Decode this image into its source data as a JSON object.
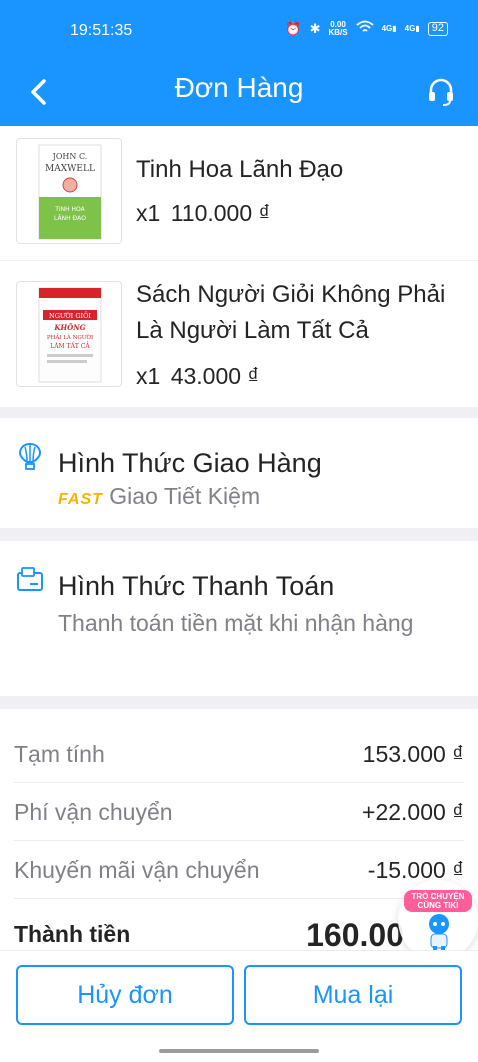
{
  "status_bar": {
    "time": "19:51:35",
    "net_speed_top": "0.00",
    "net_speed_bottom": "KB/S",
    "signal1": "4G",
    "signal2": "4G",
    "battery": "92"
  },
  "header": {
    "title": "Đơn Hàng",
    "back_icon": "chevron-left-icon",
    "support_icon": "headset-icon"
  },
  "products": [
    {
      "name": "Tinh Hoa Lãnh Đạo",
      "qty": "x1",
      "price": "110.000 ₫",
      "cover_author": "JOHN C. MAXWELL",
      "cover_title": "TINH HOA LÃNH ĐẠO"
    },
    {
      "name": "Sách Người Giỏi Không Phải Là Người Làm Tất Cả",
      "qty": "x1",
      "price": "43.000 ₫",
      "cover_title": "NGƯỜI GIỎI KHÔNG PHẢI LÀ NGƯỜI LÀM TẤT CẢ"
    }
  ],
  "shipping": {
    "title": "Hình Thức Giao Hàng",
    "badge": "FAST",
    "method": "Giao Tiết Kiệm",
    "icon": "shipping-balloon-icon"
  },
  "payment": {
    "title": "Hình Thức Thanh Toán",
    "method": "Thanh toán tiền mặt khi nhận hàng",
    "icon": "payment-card-icon"
  },
  "summary": {
    "rows": [
      {
        "label": "Tạm tính",
        "value": "153.000 ₫"
      },
      {
        "label": "Phí vận chuyển",
        "value": "+22.000 ₫"
      },
      {
        "label": "Khuyến mãi vận chuyển",
        "value": "-15.000 ₫"
      }
    ],
    "total_label": "Thành tiền",
    "total_value": "160.00"
  },
  "chat": {
    "label": "TRÒ CHUYỆN CÙNG TIKI"
  },
  "actions": {
    "cancel": "Hủy đơn",
    "rebuy": "Mua lại"
  },
  "colors": {
    "primary": "#1a94ff",
    "fast": "#f6b300",
    "muted": "#808089"
  }
}
